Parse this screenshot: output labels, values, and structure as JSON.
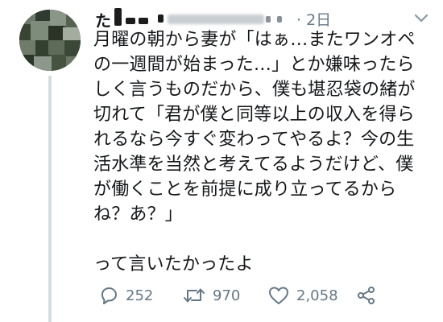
{
  "tweet": {
    "author_initial": "た",
    "timestamp": "· 2日",
    "body": "月曜の朝から妻が「はぁ…またワンオペ\nの一週間が始まった…」とか嫌味ったら\nしく言うものだから、僕も堪忍袋の緒が\n切れて「君が僕と同等以上の収入を得ら\nれるなら今すぐ変わってやるよ？今の生\n活水準を当然と考えてるようだけど、僕\nが働くことを前提に成り立ってるから\nね？あ？」\n\nって言いたかったよ",
    "actions": {
      "reply_count": "252",
      "retweet_count": "970",
      "like_count": "2,058"
    }
  },
  "icons": {
    "reply": "reply-icon",
    "retweet": "retweet-icon",
    "like": "heart-icon",
    "share": "share-icon",
    "caret": "chevron-down-icon"
  },
  "colors": {
    "text": "#14171a",
    "secondary": "#657786",
    "thread_line": "#d5dde3"
  }
}
